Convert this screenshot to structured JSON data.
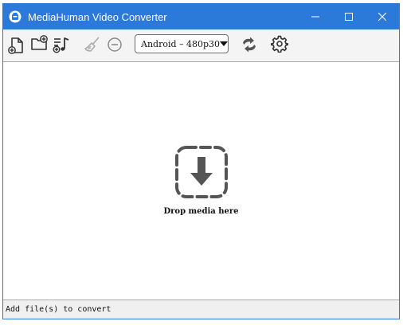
{
  "window": {
    "title": "MediaHuman Video Converter"
  },
  "toolbar": {
    "buttons": [
      {
        "name": "add-file-button",
        "icon": "add-file-icon"
      },
      {
        "name": "add-folder-button",
        "icon": "add-folder-icon"
      },
      {
        "name": "add-music-button",
        "icon": "add-music-icon"
      },
      {
        "name": "clear-list-button",
        "icon": "broom-icon"
      },
      {
        "name": "remove-item-button",
        "icon": "minus-circle-icon"
      },
      {
        "name": "convert-button",
        "icon": "convert-arrows-icon"
      },
      {
        "name": "settings-button",
        "icon": "gear-icon"
      }
    ],
    "preset": {
      "selected": "Android – 480p30"
    }
  },
  "main": {
    "drop_label": "Drop media here",
    "drop_icon": "download-arrow-icon"
  },
  "status": {
    "text": "Add file(s) to convert"
  },
  "colors": {
    "titlebar": "#2b79d8",
    "toolbar_bg": "#f4f4f4",
    "icon_dark": "#333333",
    "icon_disabled": "#a9a9a9",
    "drop_icon": "#555555"
  }
}
